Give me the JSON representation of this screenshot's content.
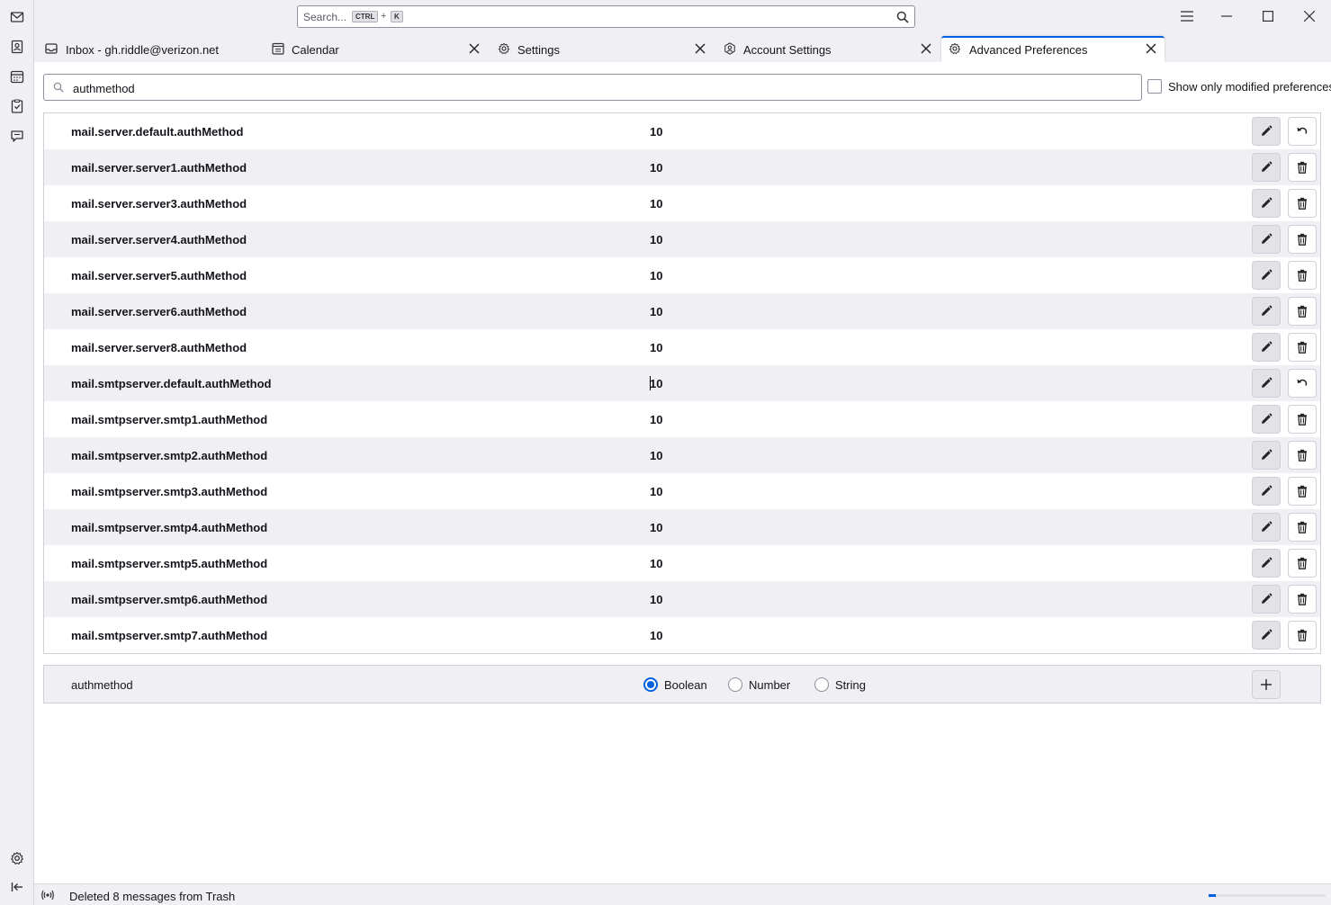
{
  "search": {
    "placeholder": "Search...",
    "shortcut_ctrl": "CTRL",
    "shortcut_plus": "+",
    "shortcut_key": "K"
  },
  "tabs": [
    {
      "label": "Inbox - gh.riddle@verizon.net",
      "icon": "mail-inbox-icon"
    },
    {
      "label": "Calendar",
      "icon": "calendar-icon"
    },
    {
      "label": "Settings",
      "icon": "gear-icon"
    },
    {
      "label": "Account Settings",
      "icon": "account-gear-icon"
    },
    {
      "label": "Advanced Preferences",
      "icon": "gear-icon",
      "selected": true
    }
  ],
  "filter": {
    "value": "authmethod",
    "show_modified_label": "Show only modified preferences",
    "show_modified_checked": false
  },
  "prefs": [
    {
      "name": "mail.server.default.authMethod",
      "value": "10",
      "action": "reset"
    },
    {
      "name": "mail.server.server1.authMethod",
      "value": "10",
      "action": "delete"
    },
    {
      "name": "mail.server.server3.authMethod",
      "value": "10",
      "action": "delete"
    },
    {
      "name": "mail.server.server4.authMethod",
      "value": "10",
      "action": "delete"
    },
    {
      "name": "mail.server.server5.authMethod",
      "value": "10",
      "action": "delete"
    },
    {
      "name": "mail.server.server6.authMethod",
      "value": "10",
      "action": "delete"
    },
    {
      "name": "mail.server.server8.authMethod",
      "value": "10",
      "action": "delete"
    },
    {
      "name": "mail.smtpserver.default.authMethod",
      "value": "10",
      "action": "reset"
    },
    {
      "name": "mail.smtpserver.smtp1.authMethod",
      "value": "10",
      "action": "delete"
    },
    {
      "name": "mail.smtpserver.smtp2.authMethod",
      "value": "10",
      "action": "delete"
    },
    {
      "name": "mail.smtpserver.smtp3.authMethod",
      "value": "10",
      "action": "delete"
    },
    {
      "name": "mail.smtpserver.smtp4.authMethod",
      "value": "10",
      "action": "delete"
    },
    {
      "name": "mail.smtpserver.smtp5.authMethod",
      "value": "10",
      "action": "delete"
    },
    {
      "name": "mail.smtpserver.smtp6.authMethod",
      "value": "10",
      "action": "delete"
    },
    {
      "name": "mail.smtpserver.smtp7.authMethod",
      "value": "10",
      "action": "delete"
    }
  ],
  "add_pref": {
    "name": "authmethod",
    "types": [
      {
        "label": "Boolean",
        "selected": true
      },
      {
        "label": "Number",
        "selected": false
      },
      {
        "label": "String",
        "selected": false
      }
    ]
  },
  "status": {
    "message": "Deleted 8 messages from Trash",
    "progress": 0.06
  },
  "colors": {
    "accent": "#0061e0",
    "row_alt": "#f0f0f4"
  }
}
